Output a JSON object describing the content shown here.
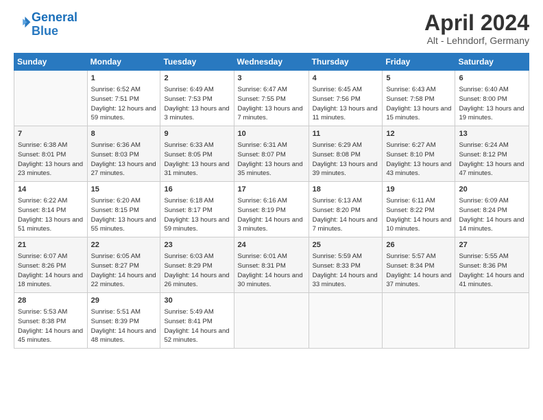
{
  "header": {
    "logo_line1": "General",
    "logo_line2": "Blue",
    "month": "April 2024",
    "location": "Alt - Lehndorf, Germany"
  },
  "days_of_week": [
    "Sunday",
    "Monday",
    "Tuesday",
    "Wednesday",
    "Thursday",
    "Friday",
    "Saturday"
  ],
  "weeks": [
    [
      {
        "num": "",
        "sunrise": "",
        "sunset": "",
        "daylight": ""
      },
      {
        "num": "1",
        "sunrise": "Sunrise: 6:52 AM",
        "sunset": "Sunset: 7:51 PM",
        "daylight": "Daylight: 12 hours and 59 minutes."
      },
      {
        "num": "2",
        "sunrise": "Sunrise: 6:49 AM",
        "sunset": "Sunset: 7:53 PM",
        "daylight": "Daylight: 13 hours and 3 minutes."
      },
      {
        "num": "3",
        "sunrise": "Sunrise: 6:47 AM",
        "sunset": "Sunset: 7:55 PM",
        "daylight": "Daylight: 13 hours and 7 minutes."
      },
      {
        "num": "4",
        "sunrise": "Sunrise: 6:45 AM",
        "sunset": "Sunset: 7:56 PM",
        "daylight": "Daylight: 13 hours and 11 minutes."
      },
      {
        "num": "5",
        "sunrise": "Sunrise: 6:43 AM",
        "sunset": "Sunset: 7:58 PM",
        "daylight": "Daylight: 13 hours and 15 minutes."
      },
      {
        "num": "6",
        "sunrise": "Sunrise: 6:40 AM",
        "sunset": "Sunset: 8:00 PM",
        "daylight": "Daylight: 13 hours and 19 minutes."
      }
    ],
    [
      {
        "num": "7",
        "sunrise": "Sunrise: 6:38 AM",
        "sunset": "Sunset: 8:01 PM",
        "daylight": "Daylight: 13 hours and 23 minutes."
      },
      {
        "num": "8",
        "sunrise": "Sunrise: 6:36 AM",
        "sunset": "Sunset: 8:03 PM",
        "daylight": "Daylight: 13 hours and 27 minutes."
      },
      {
        "num": "9",
        "sunrise": "Sunrise: 6:33 AM",
        "sunset": "Sunset: 8:05 PM",
        "daylight": "Daylight: 13 hours and 31 minutes."
      },
      {
        "num": "10",
        "sunrise": "Sunrise: 6:31 AM",
        "sunset": "Sunset: 8:07 PM",
        "daylight": "Daylight: 13 hours and 35 minutes."
      },
      {
        "num": "11",
        "sunrise": "Sunrise: 6:29 AM",
        "sunset": "Sunset: 8:08 PM",
        "daylight": "Daylight: 13 hours and 39 minutes."
      },
      {
        "num": "12",
        "sunrise": "Sunrise: 6:27 AM",
        "sunset": "Sunset: 8:10 PM",
        "daylight": "Daylight: 13 hours and 43 minutes."
      },
      {
        "num": "13",
        "sunrise": "Sunrise: 6:24 AM",
        "sunset": "Sunset: 8:12 PM",
        "daylight": "Daylight: 13 hours and 47 minutes."
      }
    ],
    [
      {
        "num": "14",
        "sunrise": "Sunrise: 6:22 AM",
        "sunset": "Sunset: 8:14 PM",
        "daylight": "Daylight: 13 hours and 51 minutes."
      },
      {
        "num": "15",
        "sunrise": "Sunrise: 6:20 AM",
        "sunset": "Sunset: 8:15 PM",
        "daylight": "Daylight: 13 hours and 55 minutes."
      },
      {
        "num": "16",
        "sunrise": "Sunrise: 6:18 AM",
        "sunset": "Sunset: 8:17 PM",
        "daylight": "Daylight: 13 hours and 59 minutes."
      },
      {
        "num": "17",
        "sunrise": "Sunrise: 6:16 AM",
        "sunset": "Sunset: 8:19 PM",
        "daylight": "Daylight: 14 hours and 3 minutes."
      },
      {
        "num": "18",
        "sunrise": "Sunrise: 6:13 AM",
        "sunset": "Sunset: 8:20 PM",
        "daylight": "Daylight: 14 hours and 7 minutes."
      },
      {
        "num": "19",
        "sunrise": "Sunrise: 6:11 AM",
        "sunset": "Sunset: 8:22 PM",
        "daylight": "Daylight: 14 hours and 10 minutes."
      },
      {
        "num": "20",
        "sunrise": "Sunrise: 6:09 AM",
        "sunset": "Sunset: 8:24 PM",
        "daylight": "Daylight: 14 hours and 14 minutes."
      }
    ],
    [
      {
        "num": "21",
        "sunrise": "Sunrise: 6:07 AM",
        "sunset": "Sunset: 8:26 PM",
        "daylight": "Daylight: 14 hours and 18 minutes."
      },
      {
        "num": "22",
        "sunrise": "Sunrise: 6:05 AM",
        "sunset": "Sunset: 8:27 PM",
        "daylight": "Daylight: 14 hours and 22 minutes."
      },
      {
        "num": "23",
        "sunrise": "Sunrise: 6:03 AM",
        "sunset": "Sunset: 8:29 PM",
        "daylight": "Daylight: 14 hours and 26 minutes."
      },
      {
        "num": "24",
        "sunrise": "Sunrise: 6:01 AM",
        "sunset": "Sunset: 8:31 PM",
        "daylight": "Daylight: 14 hours and 30 minutes."
      },
      {
        "num": "25",
        "sunrise": "Sunrise: 5:59 AM",
        "sunset": "Sunset: 8:33 PM",
        "daylight": "Daylight: 14 hours and 33 minutes."
      },
      {
        "num": "26",
        "sunrise": "Sunrise: 5:57 AM",
        "sunset": "Sunset: 8:34 PM",
        "daylight": "Daylight: 14 hours and 37 minutes."
      },
      {
        "num": "27",
        "sunrise": "Sunrise: 5:55 AM",
        "sunset": "Sunset: 8:36 PM",
        "daylight": "Daylight: 14 hours and 41 minutes."
      }
    ],
    [
      {
        "num": "28",
        "sunrise": "Sunrise: 5:53 AM",
        "sunset": "Sunset: 8:38 PM",
        "daylight": "Daylight: 14 hours and 45 minutes."
      },
      {
        "num": "29",
        "sunrise": "Sunrise: 5:51 AM",
        "sunset": "Sunset: 8:39 PM",
        "daylight": "Daylight: 14 hours and 48 minutes."
      },
      {
        "num": "30",
        "sunrise": "Sunrise: 5:49 AM",
        "sunset": "Sunset: 8:41 PM",
        "daylight": "Daylight: 14 hours and 52 minutes."
      },
      {
        "num": "",
        "sunrise": "",
        "sunset": "",
        "daylight": ""
      },
      {
        "num": "",
        "sunrise": "",
        "sunset": "",
        "daylight": ""
      },
      {
        "num": "",
        "sunrise": "",
        "sunset": "",
        "daylight": ""
      },
      {
        "num": "",
        "sunrise": "",
        "sunset": "",
        "daylight": ""
      }
    ]
  ]
}
